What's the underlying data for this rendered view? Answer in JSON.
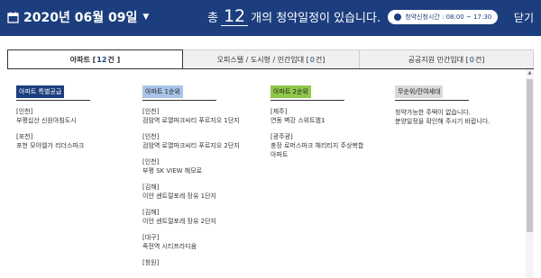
{
  "header": {
    "date": "2020년 06월 09일",
    "summary_prefix": "총",
    "count": "12",
    "summary_suffix": "개의 청약일정이 있습니다.",
    "hours": "청약신청시간 : 08:00 ~ 17:30",
    "close": "닫기"
  },
  "tabs": [
    {
      "label": "아파트 [",
      "count": "12",
      "suffix": "건 ]"
    },
    {
      "label": "오피스텔 / 도시형 / 민간임대 [",
      "count": "0",
      "suffix": "건]"
    },
    {
      "label": "공공지원 민간임대 [",
      "count": "0",
      "suffix": "건]"
    }
  ],
  "columns": [
    {
      "category": "아파트 특별공급",
      "color": "#1c3e7e",
      "entries": [
        {
          "region": "[인천]",
          "name": "부평십산 신원아침도시"
        },
        {
          "region": "[포천]",
          "name": "포천 모아엘가 리더스파크"
        }
      ]
    },
    {
      "category": "아파트 1순위",
      "color": "#a9c4e8",
      "entries": [
        {
          "region": "[인천]",
          "name": "검암역 로열파크씨티 푸르지오 1단지"
        },
        {
          "region": "[인천]",
          "name": "검암역 로열파크씨티 푸르지오 2단지"
        },
        {
          "region": "[인천]",
          "name": "부평 SK VIEW 해모로"
        },
        {
          "region": "[김해]",
          "name": "이안 센트럴포레 장유 1단지"
        },
        {
          "region": "[김해]",
          "name": "이안 센트럴포레 장유 2단지"
        },
        {
          "region": "[대구]",
          "name": "죽전역 시티프라디움"
        },
        {
          "region": "[창원]",
          "name": ""
        }
      ]
    },
    {
      "category": "아파트 2순위",
      "color": "#8fc84a",
      "entries": [
        {
          "region": "[제주]",
          "name": "연동 벽강 스위트엠1"
        },
        {
          "region": "[광주광]",
          "name": "충장 로머스파크 헤리티지 주상복합",
          "name2": "아파트"
        }
      ]
    },
    {
      "category": "무순위/잔여세대",
      "color": "#d9d9d9",
      "notice": [
        "청약가능한 주택이 없습니다.",
        "분양일정을 확인해 주시기 바랍니다."
      ]
    }
  ]
}
